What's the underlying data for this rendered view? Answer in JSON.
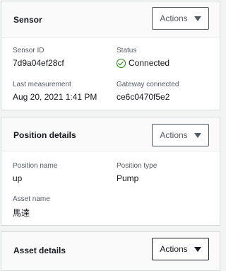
{
  "sensor_panel": {
    "title": "Sensor",
    "actions_label": "Actions",
    "sensor_id": {
      "label": "Sensor ID",
      "value": "7d9a04ef28cf"
    },
    "status": {
      "label": "Status",
      "value": "Connected"
    },
    "last_measurement": {
      "label": "Last measurement",
      "value": "Aug 20, 2021 1:41 PM"
    },
    "gateway": {
      "label": "Gateway connected",
      "value": "ce6c0470f5e2"
    }
  },
  "position_panel": {
    "title": "Position details",
    "actions_label": "Actions",
    "position_name": {
      "label": "Position name",
      "value": "up"
    },
    "position_type": {
      "label": "Position type",
      "value": "Pump"
    },
    "asset_name": {
      "label": "Asset name",
      "value": "馬達"
    }
  },
  "asset_panel": {
    "title": "Asset details",
    "actions_label": "Actions"
  },
  "colors": {
    "status_ok": "#1d8102",
    "text": "#16191f",
    "muted": "#545b64"
  }
}
